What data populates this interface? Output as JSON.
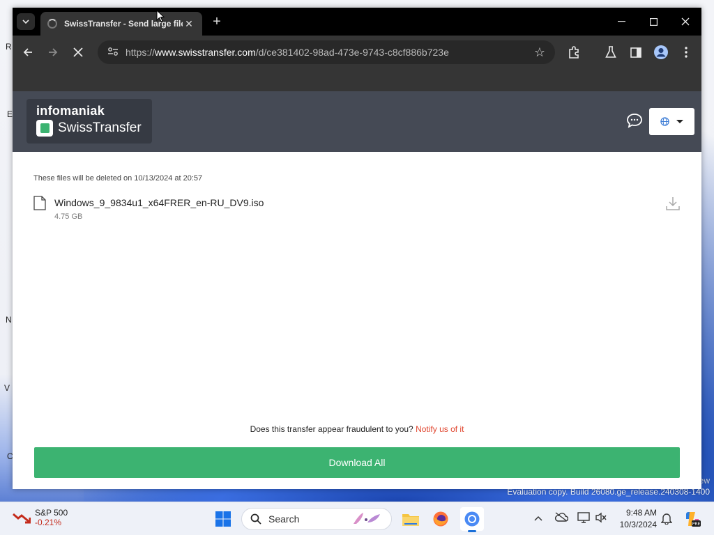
{
  "desktop": {
    "watermark_line1": "ew",
    "watermark_line2": "Evaluation copy. Build 26080.ge_release.240308-1400",
    "icon_letters": [
      "R",
      "E",
      "N",
      "V",
      "C"
    ]
  },
  "browser": {
    "tab": {
      "title": "SwissTransfer - Send large files",
      "close_label": "✕"
    },
    "new_tab_label": "+",
    "url_scheme": "https://",
    "url_host": "www.swisstransfer.com",
    "url_path": "/d/ce381402-98ad-473e-9743-c8cf886b723e"
  },
  "site": {
    "brand_top": "infomaniak",
    "brand_bottom": "SwissTransfer",
    "deletion_note": "These files will be deleted on 10/13/2024 at 20:57",
    "files": [
      {
        "name": "Windows_9_9834u1_x64FRER_en-RU_DV9.iso",
        "size": "4.75 GB"
      }
    ],
    "fraud_question": "Does this transfer appear fraudulent to you?",
    "fraud_link": "Notify us of it",
    "download_all": "Download All",
    "colors": {
      "accent_green": "#3cb371",
      "header_bg": "#454a55",
      "fraud_link": "#e0452e"
    }
  },
  "taskbar": {
    "stock_name": "S&P 500",
    "stock_change": "-0.21%",
    "search_label": "Search",
    "time": "9:48 AM",
    "date": "10/3/2024",
    "copilot_badge": "PRE"
  }
}
